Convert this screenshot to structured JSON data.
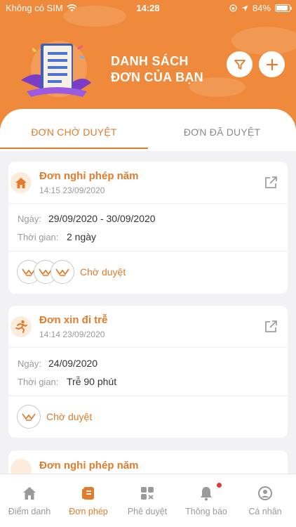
{
  "status_bar": {
    "carrier": "Không có SIM",
    "time": "14:28",
    "battery": "84%"
  },
  "header": {
    "title_line1": "DANH SÁCH",
    "title_line2": "ĐƠN CỦA BẠN",
    "filter_icon": "filter-icon",
    "add_icon": "plus-icon"
  },
  "tabs": [
    {
      "label": "ĐƠN CHỜ DUYỆT",
      "active": true
    },
    {
      "label": "ĐƠN ĐÃ DUYỆT",
      "active": false
    }
  ],
  "requests": [
    {
      "icon": "home-icon",
      "title": "Đơn nghỉ phép năm",
      "timestamp": "14:15 23/09/2020",
      "date_label": "Ngày:",
      "date_value": "29/09/2020 - 30/09/2020",
      "duration_label": "Thời gian:",
      "duration_value": "2 ngày",
      "approvers": 3,
      "status": "Chờ duyệt"
    },
    {
      "icon": "running-person-icon",
      "title": "Đơn xin đi trễ",
      "timestamp": "14:14 23/09/2020",
      "date_label": "Ngày:",
      "date_value": "24/09/2020",
      "duration_label": "Thời gian:",
      "duration_value": "Trễ 90 phút",
      "approvers": 1,
      "status": "Chờ duyệt"
    },
    {
      "icon": "home-icon",
      "title": "Đơn nghỉ phép năm"
    }
  ],
  "bottom_nav": [
    {
      "label": "Điểm danh",
      "icon": "home-icon",
      "active": false
    },
    {
      "label": "Đơn phép",
      "icon": "document-icon",
      "active": true
    },
    {
      "label": "Phê duyệt",
      "icon": "grid-check-icon",
      "active": false
    },
    {
      "label": "Thông báo",
      "icon": "bell-icon",
      "active": false,
      "badge": true
    },
    {
      "label": "Cá nhân",
      "icon": "user-icon",
      "active": false
    }
  ],
  "colors": {
    "brand": "#ef8a3c",
    "accent": "#e07c2c",
    "muted": "#9a9a9a",
    "badge": "#e53935"
  }
}
